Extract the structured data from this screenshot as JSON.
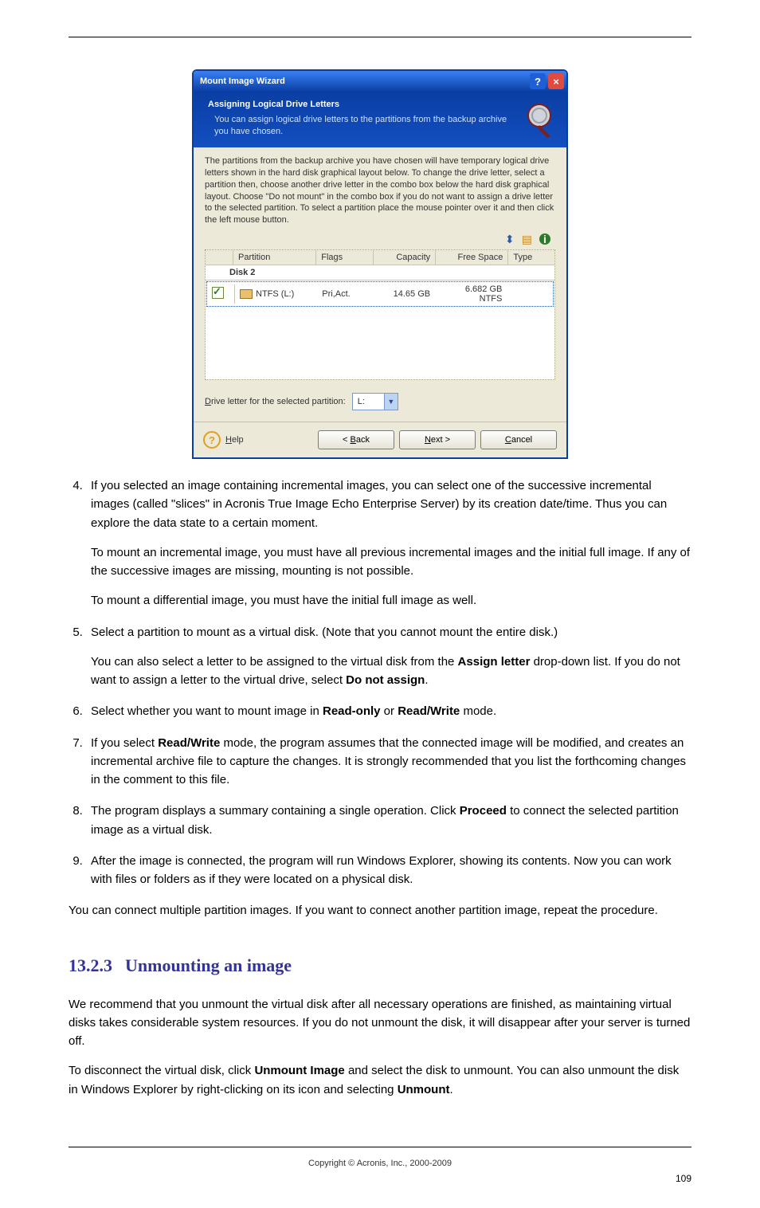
{
  "wizard": {
    "window_title": "Mount Image Wizard",
    "banner_title": "Assigning Logical Drive Letters",
    "banner_sub": "You can assign logical drive letters to the partitions from the backup archive you have chosen.",
    "instructions": "The partitions from the backup archive you have chosen will have temporary logical drive letters shown in the hard disk graphical layout below. To change the drive letter, select a partition then, choose another drive letter in the combo box below the hard disk graphical layout. Choose \"Do not mount\" in the combo box if you do not want to assign a drive letter to the selected partition. To select a partition place the mouse pointer over it and then click the left mouse button.",
    "columns": {
      "partition": "Partition",
      "flags": "Flags",
      "capacity": "Capacity",
      "free": "Free Space",
      "type": "Type"
    },
    "disk_label": "Disk 2",
    "row": {
      "name": "NTFS (L:)",
      "flags": "Pri,Act.",
      "capacity": "14.65 GB",
      "free": "6.682 GB",
      "type": "NTFS"
    },
    "drive_letter_label_pre": "D",
    "drive_letter_label_rest": "rive letter for the selected partition:",
    "drive_letter_value": "L:",
    "help_pre": "H",
    "help_rest": "elp",
    "back_pre": "B",
    "back_label": "< ",
    "back_rest": "ack",
    "next_pre": "N",
    "next_rest": "ext >",
    "cancel_pre": "C",
    "cancel_rest": "ancel"
  },
  "doc": {
    "li4_a": "If you selected an image containing incremental images, you can select one of the successive incremental images (called \"slices\" in Acronis True Image Echo Enterprise Server) by its creation date/time. Thus you can explore the data state to a certain moment.",
    "li4_b": "To mount an incremental image, you must have all previous incremental images and the initial full image. If any of the successive images are missing, mounting is not possible.",
    "li4_c": "To mount a differential image, you must have the initial full image as well.",
    "li5_a": "Select a partition to mount as a virtual disk. (Note that you cannot mount the entire disk.)",
    "li5_b": "You can also select a letter to be assigned to the virtual disk from the ",
    "li5_c": "Assign letter",
    "li5_d": " drop-down list. If you do not want to assign a letter to the virtual drive, select ",
    "li5_e": "Do not assign",
    "li5_f": ".",
    "li6_a": "Select whether you want to mount image in ",
    "li6_ro": "Read-only",
    "li6_b": " or ",
    "li6_rw": "Read/Write",
    "li6_c": " mode.",
    "li7_a": "If you select ",
    "li7_rw": "Read/Write",
    "li7_b": " mode, the program assumes that the connected image will be modified, and creates an incremental archive file to capture the changes. It is strongly recommended that you list the forthcoming changes in the comment to this file.",
    "li8_a": "The program displays a summary containing a single operation. Click ",
    "li8_b": "Proceed",
    "li8_c": " to connect the selected partition image as a virtual disk.",
    "li9": "After the image is connected, the program will run Windows Explorer, showing its contents. Now you can work with files or folders as if they were located on a physical disk.",
    "p_multi": "You can connect multiple partition images. If you want to connect another partition image, repeat the procedure.",
    "h2_num": "13.2.3",
    "h2_title": "Unmounting an image",
    "p_unmount_a": "We recommend that you unmount the virtual disk after all necessary operations are finished, as maintaining virtual disks takes considerable system resources. If you do not unmount the disk, it will disappear after your server is turned off.",
    "p_unmount_b_1": "To disconnect the virtual disk, click ",
    "p_unmount_b_2": "Unmount Image",
    "p_unmount_b_3": " and select the disk to unmount. You can also unmount the disk in Windows Explorer by right-clicking on its icon and selecting ",
    "p_unmount_c": "Unmount",
    "p_unmount_d": "."
  },
  "footer": {
    "copyright": "Copyright © Acronis, Inc., 2000-2009",
    "page": "109"
  }
}
